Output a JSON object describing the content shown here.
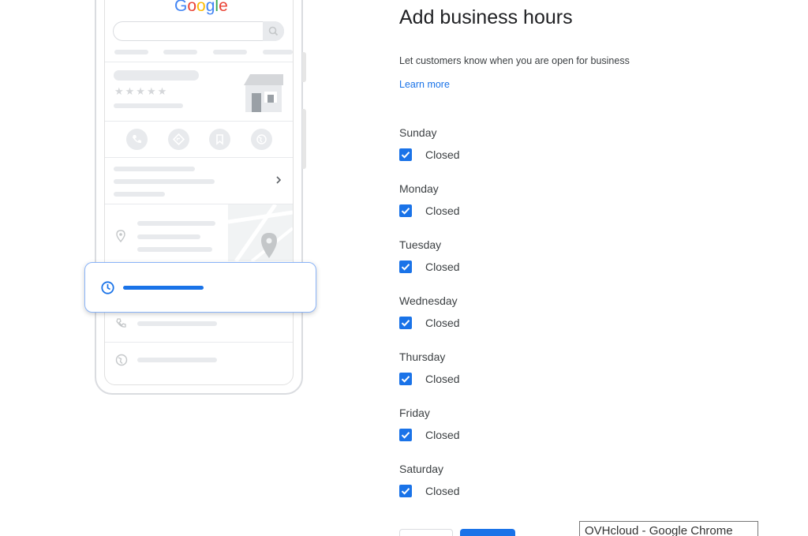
{
  "illustration": {
    "logo_letters": [
      "G",
      "o",
      "o",
      "g",
      "l",
      "e"
    ]
  },
  "form": {
    "title": "Add business hours",
    "subtitle": "Let customers know when you are open for business",
    "learn_more": "Learn more",
    "days": [
      {
        "name": "Sunday",
        "closed_label": "Closed",
        "closed": true
      },
      {
        "name": "Monday",
        "closed_label": "Closed",
        "closed": true
      },
      {
        "name": "Tuesday",
        "closed_label": "Closed",
        "closed": true
      },
      {
        "name": "Wednesday",
        "closed_label": "Closed",
        "closed": true
      },
      {
        "name": "Thursday",
        "closed_label": "Closed",
        "closed": true
      },
      {
        "name": "Friday",
        "closed_label": "Closed",
        "closed": true
      },
      {
        "name": "Saturday",
        "closed_label": "Closed",
        "closed": true
      }
    ]
  },
  "tooltip": {
    "text": "OVHcloud - Google Chrome"
  },
  "colors": {
    "accent": "#1a73e8",
    "text": "#3c4043",
    "title": "#202124",
    "placeholder_gray": "#e8eaed"
  }
}
